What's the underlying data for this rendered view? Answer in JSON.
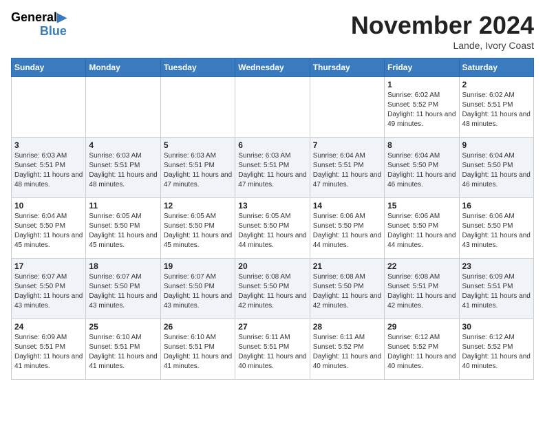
{
  "header": {
    "logo_line1": "General",
    "logo_line2": "Blue",
    "month": "November 2024",
    "location": "Lande, Ivory Coast"
  },
  "weekdays": [
    "Sunday",
    "Monday",
    "Tuesday",
    "Wednesday",
    "Thursday",
    "Friday",
    "Saturday"
  ],
  "weeks": [
    [
      {
        "day": "",
        "info": ""
      },
      {
        "day": "",
        "info": ""
      },
      {
        "day": "",
        "info": ""
      },
      {
        "day": "",
        "info": ""
      },
      {
        "day": "",
        "info": ""
      },
      {
        "day": "1",
        "info": "Sunrise: 6:02 AM\nSunset: 5:52 PM\nDaylight: 11 hours and 49 minutes."
      },
      {
        "day": "2",
        "info": "Sunrise: 6:02 AM\nSunset: 5:51 PM\nDaylight: 11 hours and 48 minutes."
      }
    ],
    [
      {
        "day": "3",
        "info": "Sunrise: 6:03 AM\nSunset: 5:51 PM\nDaylight: 11 hours and 48 minutes."
      },
      {
        "day": "4",
        "info": "Sunrise: 6:03 AM\nSunset: 5:51 PM\nDaylight: 11 hours and 48 minutes."
      },
      {
        "day": "5",
        "info": "Sunrise: 6:03 AM\nSunset: 5:51 PM\nDaylight: 11 hours and 47 minutes."
      },
      {
        "day": "6",
        "info": "Sunrise: 6:03 AM\nSunset: 5:51 PM\nDaylight: 11 hours and 47 minutes."
      },
      {
        "day": "7",
        "info": "Sunrise: 6:04 AM\nSunset: 5:51 PM\nDaylight: 11 hours and 47 minutes."
      },
      {
        "day": "8",
        "info": "Sunrise: 6:04 AM\nSunset: 5:50 PM\nDaylight: 11 hours and 46 minutes."
      },
      {
        "day": "9",
        "info": "Sunrise: 6:04 AM\nSunset: 5:50 PM\nDaylight: 11 hours and 46 minutes."
      }
    ],
    [
      {
        "day": "10",
        "info": "Sunrise: 6:04 AM\nSunset: 5:50 PM\nDaylight: 11 hours and 45 minutes."
      },
      {
        "day": "11",
        "info": "Sunrise: 6:05 AM\nSunset: 5:50 PM\nDaylight: 11 hours and 45 minutes."
      },
      {
        "day": "12",
        "info": "Sunrise: 6:05 AM\nSunset: 5:50 PM\nDaylight: 11 hours and 45 minutes."
      },
      {
        "day": "13",
        "info": "Sunrise: 6:05 AM\nSunset: 5:50 PM\nDaylight: 11 hours and 44 minutes."
      },
      {
        "day": "14",
        "info": "Sunrise: 6:06 AM\nSunset: 5:50 PM\nDaylight: 11 hours and 44 minutes."
      },
      {
        "day": "15",
        "info": "Sunrise: 6:06 AM\nSunset: 5:50 PM\nDaylight: 11 hours and 44 minutes."
      },
      {
        "day": "16",
        "info": "Sunrise: 6:06 AM\nSunset: 5:50 PM\nDaylight: 11 hours and 43 minutes."
      }
    ],
    [
      {
        "day": "17",
        "info": "Sunrise: 6:07 AM\nSunset: 5:50 PM\nDaylight: 11 hours and 43 minutes."
      },
      {
        "day": "18",
        "info": "Sunrise: 6:07 AM\nSunset: 5:50 PM\nDaylight: 11 hours and 43 minutes."
      },
      {
        "day": "19",
        "info": "Sunrise: 6:07 AM\nSunset: 5:50 PM\nDaylight: 11 hours and 43 minutes."
      },
      {
        "day": "20",
        "info": "Sunrise: 6:08 AM\nSunset: 5:50 PM\nDaylight: 11 hours and 42 minutes."
      },
      {
        "day": "21",
        "info": "Sunrise: 6:08 AM\nSunset: 5:50 PM\nDaylight: 11 hours and 42 minutes."
      },
      {
        "day": "22",
        "info": "Sunrise: 6:08 AM\nSunset: 5:51 PM\nDaylight: 11 hours and 42 minutes."
      },
      {
        "day": "23",
        "info": "Sunrise: 6:09 AM\nSunset: 5:51 PM\nDaylight: 11 hours and 41 minutes."
      }
    ],
    [
      {
        "day": "24",
        "info": "Sunrise: 6:09 AM\nSunset: 5:51 PM\nDaylight: 11 hours and 41 minutes."
      },
      {
        "day": "25",
        "info": "Sunrise: 6:10 AM\nSunset: 5:51 PM\nDaylight: 11 hours and 41 minutes."
      },
      {
        "day": "26",
        "info": "Sunrise: 6:10 AM\nSunset: 5:51 PM\nDaylight: 11 hours and 41 minutes."
      },
      {
        "day": "27",
        "info": "Sunrise: 6:11 AM\nSunset: 5:51 PM\nDaylight: 11 hours and 40 minutes."
      },
      {
        "day": "28",
        "info": "Sunrise: 6:11 AM\nSunset: 5:52 PM\nDaylight: 11 hours and 40 minutes."
      },
      {
        "day": "29",
        "info": "Sunrise: 6:12 AM\nSunset: 5:52 PM\nDaylight: 11 hours and 40 minutes."
      },
      {
        "day": "30",
        "info": "Sunrise: 6:12 AM\nSunset: 5:52 PM\nDaylight: 11 hours and 40 minutes."
      }
    ]
  ]
}
